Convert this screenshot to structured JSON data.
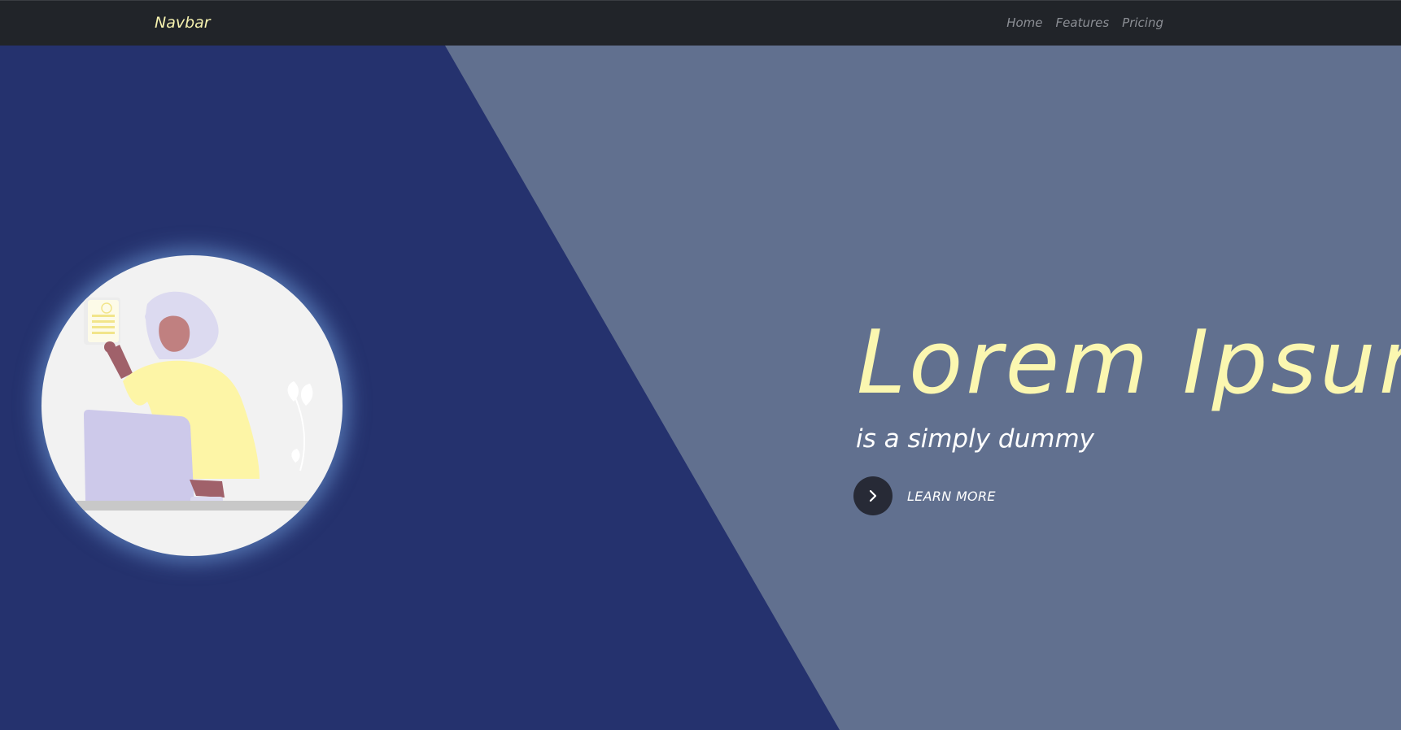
{
  "navbar": {
    "brand": "Navbar",
    "links": [
      {
        "label": "Home"
      },
      {
        "label": "Features"
      },
      {
        "label": "Pricing"
      }
    ]
  },
  "hero": {
    "title": "Lorem Ipsum",
    "subtitle": "is a simply dummy",
    "cta_label": "LEARN MORE",
    "cta_icon": "chevron-right-icon",
    "illustration": "woman-holding-document-illustration"
  },
  "colors": {
    "navbar_bg": "#212429",
    "brand": "#f7f3b0",
    "nav_link": "#8c8f95",
    "dark_panel": "#25326e",
    "light_panel": "#61708f",
    "title": "#fbf7b0",
    "subtitle": "#ffffff",
    "cta_circle": "#272a36"
  }
}
